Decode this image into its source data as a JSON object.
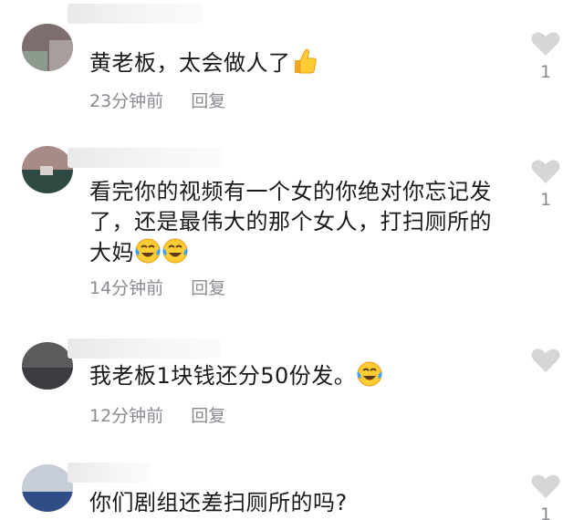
{
  "comments": [
    {
      "text": "黄老板，太会做人了",
      "emojis": [
        "thumbs-up"
      ],
      "time": "23分钟前",
      "reply": "回复",
      "likes": "1",
      "avatar_colors": [
        "#7d6d6d",
        "#8d9b8e",
        "#c9b8b5"
      ]
    },
    {
      "text_line1": "看完你的视频有一个女的你绝对你忘记发",
      "text_line2": "了，还是最伟大的那个女人，打扫厕所的",
      "text_line3": "大妈",
      "emojis": [
        "tears-of-joy",
        "tears-of-joy"
      ],
      "time": "14分钟前",
      "reply": "回复",
      "likes": "1",
      "avatar_colors": [
        "#a88a87",
        "#2f4a42",
        "#d9d2cf"
      ]
    },
    {
      "text": "我老板1块钱还分50份发。",
      "emojis": [
        "tears-of-joy"
      ],
      "time": "12分钟前",
      "reply": "回复",
      "likes": "",
      "avatar_colors": [
        "#5b5a5d",
        "#3d3b40",
        "#7a787c"
      ]
    },
    {
      "text": "你们剧组还差扫厕所的吗?",
      "emojis": [],
      "time": "",
      "reply": "",
      "likes": "1",
      "avatar_colors": [
        "#c7cdd6",
        "#2f4e86",
        "#e3e6ea"
      ]
    }
  ],
  "colors": {
    "text": "#1a1a1a",
    "meta": "#8a8b91",
    "heart": "#d6d6d8"
  }
}
